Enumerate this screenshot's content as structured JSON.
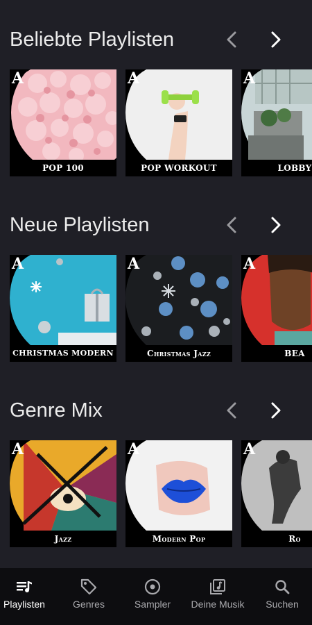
{
  "sections": [
    {
      "title": "Beliebte Playlisten",
      "cards": [
        {
          "label": "POP 100"
        },
        {
          "label": "POP WORKOUT"
        },
        {
          "label": "LOBBY"
        }
      ]
    },
    {
      "title": "Neue Playlisten",
      "cards": [
        {
          "label": "CHRISTMAS MODERN"
        },
        {
          "label": "Christmas Jazz"
        },
        {
          "label": "BEA"
        }
      ]
    },
    {
      "title": "Genre Mix",
      "cards": [
        {
          "label": "Jazz"
        },
        {
          "label": "Modern Pop"
        },
        {
          "label": "Ro"
        }
      ]
    }
  ],
  "badge_letter": "A",
  "icons": {
    "prev": "chevron-left-icon",
    "next": "chevron-right-icon"
  },
  "nav": [
    {
      "label": "Playlisten",
      "icon": "playlist-icon",
      "active": true
    },
    {
      "label": "Genres",
      "icon": "tag-icon",
      "active": false
    },
    {
      "label": "Sampler",
      "icon": "disc-icon",
      "active": false
    },
    {
      "label": "Deine Musik",
      "icon": "music-library-icon",
      "active": false
    },
    {
      "label": "Suchen",
      "icon": "search-icon",
      "active": false
    }
  ],
  "colors": {
    "background": "#1f1f26",
    "nav_background": "#0d0d10",
    "text": "#ececec",
    "inactive_arrow": "#9a9a9e"
  }
}
